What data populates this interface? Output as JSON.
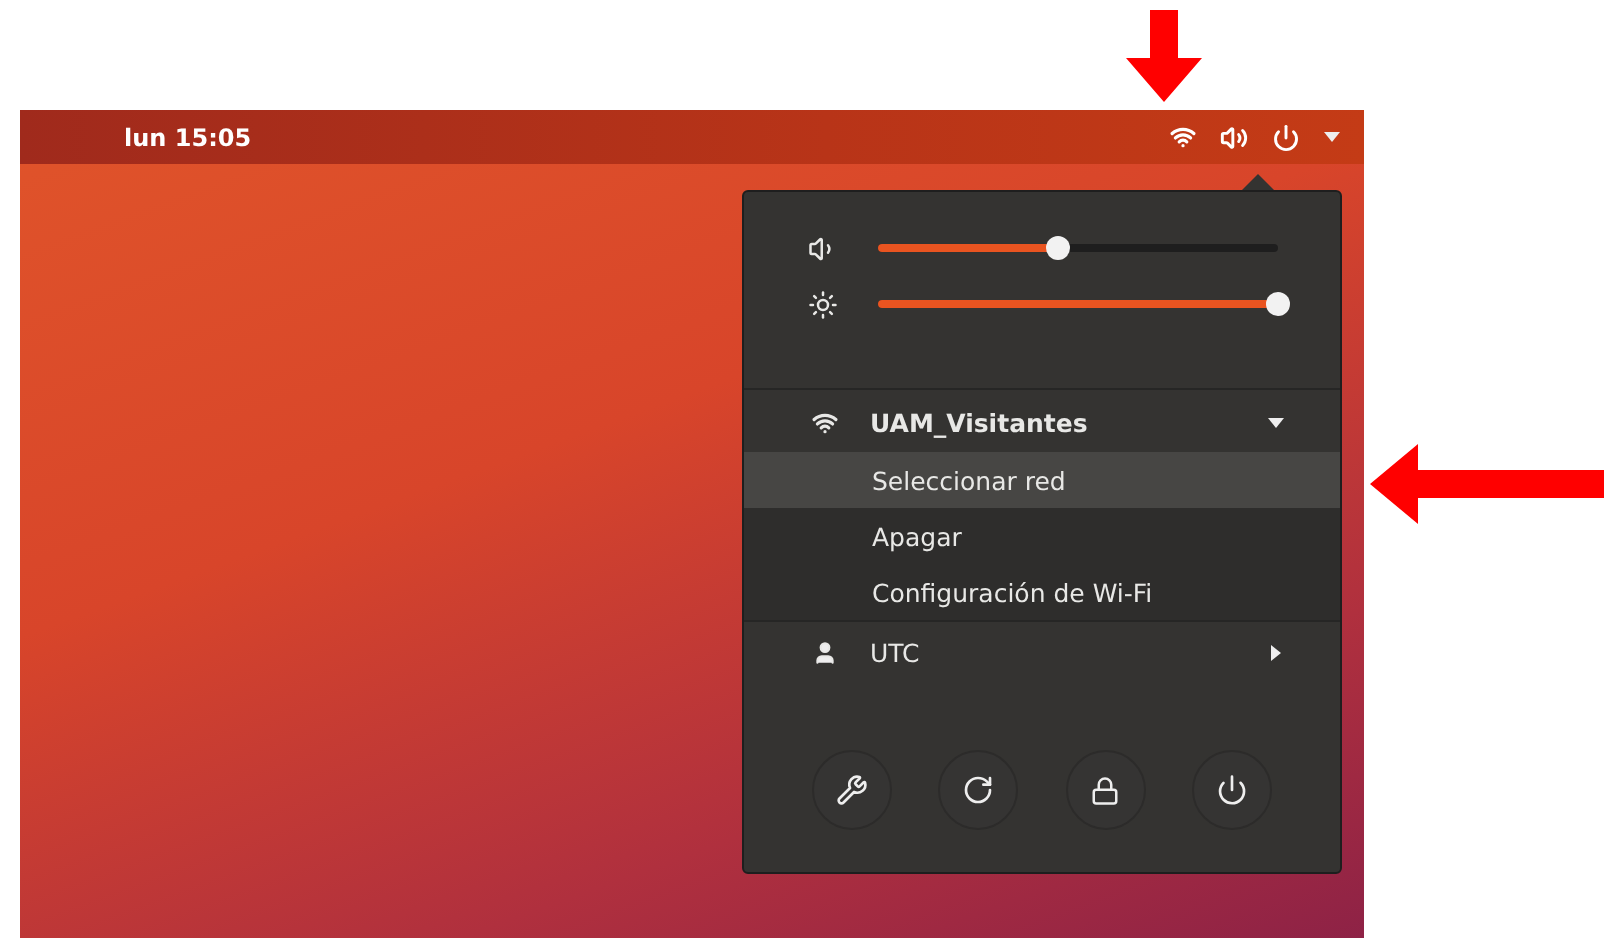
{
  "top_bar": {
    "clock": "lun 15:05"
  },
  "menu": {
    "sliders": [
      {
        "kind": "volume",
        "level": 0.45
      },
      {
        "kind": "brightness",
        "level": 1.0
      }
    ],
    "wifi": {
      "network": "UAM_Visitantes",
      "expanded": true,
      "items": [
        {
          "label": "Seleccionar red",
          "selected": true
        },
        {
          "label": "Apagar",
          "selected": false
        },
        {
          "label": "Configuración de Wi-Fi",
          "selected": false
        }
      ]
    },
    "user": {
      "label": "UTC"
    },
    "actions": [
      {
        "kind": "settings"
      },
      {
        "kind": "rotation-lock"
      },
      {
        "kind": "lock"
      },
      {
        "kind": "power"
      }
    ]
  }
}
